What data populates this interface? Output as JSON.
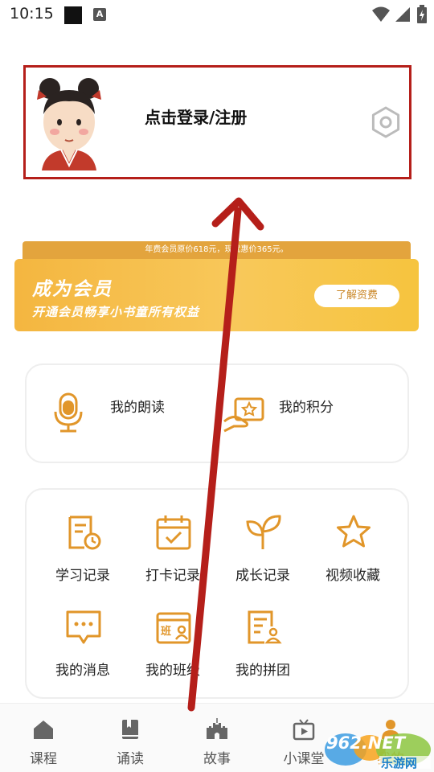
{
  "status_bar": {
    "time": "10:15",
    "notification_letter": "A"
  },
  "profile": {
    "login_label": "点击登录/注册",
    "avatar_icon": "cartoon-girl-avatar",
    "settings_icon": "hexagon-settings-icon"
  },
  "vip": {
    "note": "年费会员原价618元，现优惠价365元。",
    "title": "成为会员",
    "subtitle": "开通会员畅享小书童所有权益",
    "button_label": "了解资费"
  },
  "quick_links": [
    {
      "label": "我的朗读",
      "icon": "microphone-icon"
    },
    {
      "label": "我的积分",
      "icon": "points-card-icon"
    }
  ],
  "grid": [
    {
      "label": "学习记录",
      "icon": "study-record-icon"
    },
    {
      "label": "打卡记录",
      "icon": "checkin-calendar-icon"
    },
    {
      "label": "成长记录",
      "icon": "sprout-icon"
    },
    {
      "label": "视频收藏",
      "icon": "star-icon"
    },
    {
      "label": "我的消息",
      "icon": "message-icon"
    },
    {
      "label": "我的班级",
      "icon": "class-icon"
    },
    {
      "label": "我的拼团",
      "icon": "group-buy-icon"
    }
  ],
  "bottom_nav": [
    {
      "label": "课程",
      "icon": "home-icon"
    },
    {
      "label": "诵读",
      "icon": "book-icon"
    },
    {
      "label": "故事",
      "icon": "castle-icon"
    },
    {
      "label": "小课堂",
      "icon": "tv-icon"
    },
    {
      "label": "我的",
      "icon": "person-icon"
    }
  ],
  "watermark": {
    "brand": "962.NET",
    "name": "乐游网"
  },
  "colors": {
    "accent": "#e3a43d",
    "icon_orange": "#e1962a",
    "annotation_red": "#b51f1a"
  }
}
